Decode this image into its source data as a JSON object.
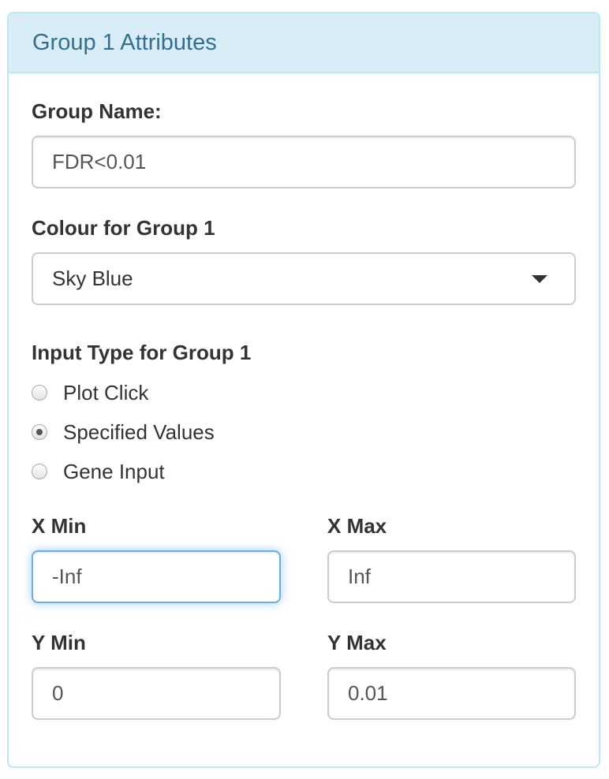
{
  "panel": {
    "title": "Group 1 Attributes"
  },
  "group_name": {
    "label": "Group Name:",
    "value": "FDR<0.01"
  },
  "colour": {
    "label": "Colour for Group 1",
    "selected": "Sky Blue"
  },
  "input_type": {
    "label": "Input Type for Group 1",
    "options": [
      "Plot Click",
      "Specified Values",
      "Gene Input"
    ],
    "selected": "Specified Values"
  },
  "x_min": {
    "label": "X Min",
    "value": "-Inf"
  },
  "x_max": {
    "label": "X Max",
    "value": "Inf"
  },
  "y_min": {
    "label": "Y Min",
    "value": "0"
  },
  "y_max": {
    "label": "Y Max",
    "value": "0.01"
  }
}
